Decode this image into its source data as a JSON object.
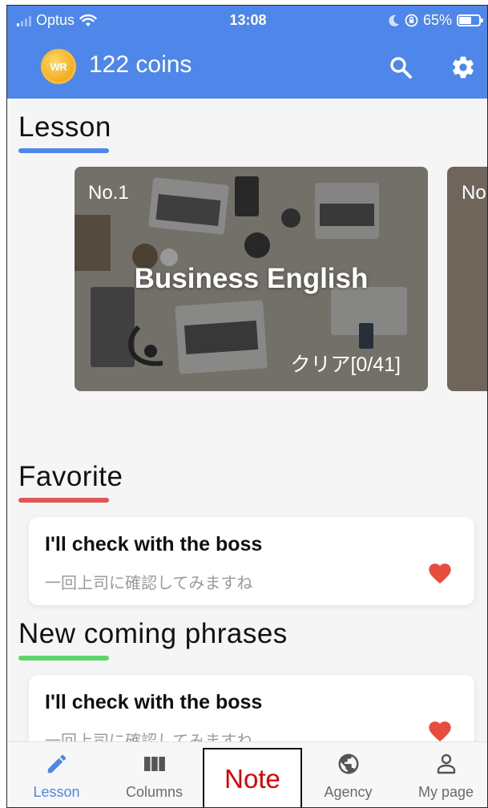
{
  "status_bar": {
    "carrier": "Optus",
    "time": "13:08",
    "battery": "65%"
  },
  "app_bar": {
    "coin_badge": "WR",
    "coins": "122 coins"
  },
  "lesson": {
    "title": "Lesson",
    "underline_color": "#4f86ea",
    "cards": [
      {
        "number": "No.1",
        "title": "Business English",
        "progress": "クリア[0/41]"
      },
      {
        "number": "No"
      }
    ]
  },
  "favorite": {
    "title": "Favorite",
    "underline_color": "#e05555",
    "items": [
      {
        "english": "I'll check with the boss",
        "japanese": "一回上司に確認してみますね"
      }
    ]
  },
  "new_phrases": {
    "title": "New coming phrases",
    "underline_color": "#5cd66a",
    "items": [
      {
        "english": "I'll check with the boss",
        "japanese": "一回上司に確認してみますね"
      }
    ]
  },
  "bottom_nav": {
    "items": [
      {
        "label": "Lesson",
        "icon": "pencil-icon",
        "active": true
      },
      {
        "label": "Columns",
        "icon": "columns-icon",
        "active": false
      },
      {
        "label": "Agency",
        "icon": "globe-icon",
        "active": false
      },
      {
        "label": "My page",
        "icon": "person-icon",
        "active": false
      }
    ],
    "note_overlay": "Note"
  },
  "colors": {
    "primary": "#4f86ea",
    "heart": "#e74c3c"
  }
}
